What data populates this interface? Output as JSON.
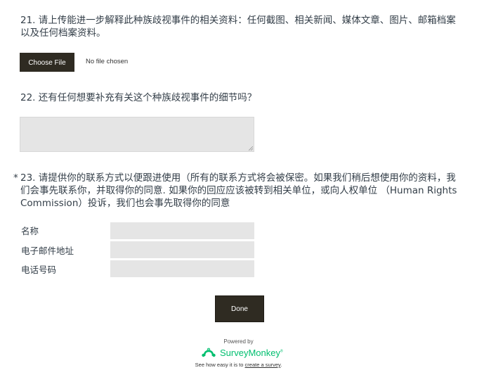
{
  "questions": {
    "q21": {
      "title": "21. 请上传能进一步解释此种族歧视事件的相关资料：任何截图、相关新闻、媒体文章、图片、邮箱档案以及任何档案资料。",
      "choose_file_label": "Choose File",
      "no_file_text": "No file chosen"
    },
    "q22": {
      "title": "22. 还有任何想要补充有关这个种族歧视事件的细节吗？",
      "textarea_value": ""
    },
    "q23": {
      "required_marker": "*",
      "title": "23. 请提供你的联系方式以便跟进使用（所有的联系方式将会被保密。如果我们稍后想使用你的资料，我们会事先联系你，并取得你的同意. 如果你的回应应该被转到相关单位，或向人权单位 （Human Rights Commission）投诉，我们也会事先取得你的同意",
      "fields": [
        {
          "label": "名称",
          "value": ""
        },
        {
          "label": "电子邮件地址",
          "value": ""
        },
        {
          "label": "电话号码",
          "value": ""
        }
      ]
    }
  },
  "done_label": "Done",
  "footer": {
    "powered_by": "Powered by",
    "brand": "SurveyMonkey",
    "brand_tm": "®",
    "see_how_prefix": "See how easy it is to ",
    "create_link": "create a survey",
    "see_how_suffix": ".",
    "brand_color": "#00bf6f"
  }
}
